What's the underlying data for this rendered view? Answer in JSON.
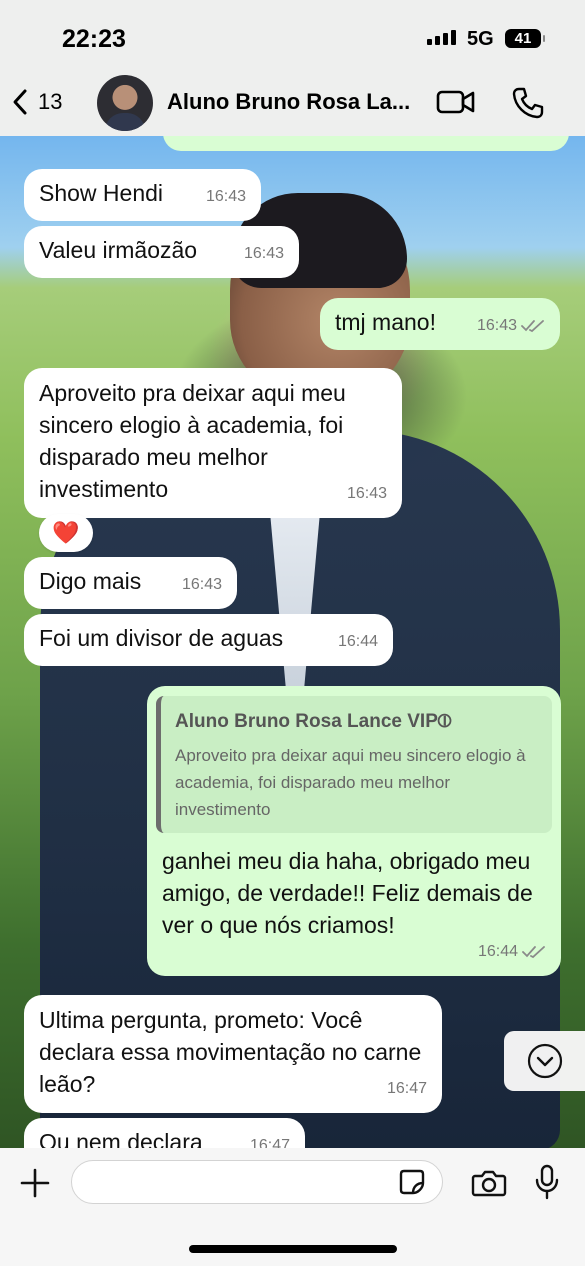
{
  "status_bar": {
    "time": "22:23",
    "network": "5G",
    "battery": "41"
  },
  "header": {
    "back_count": "13",
    "contact_name": "Aluno Bruno Rosa La..."
  },
  "messages": [
    {
      "text": "Show Hendi",
      "time": "16:43"
    },
    {
      "text": "Valeu irmãozão",
      "time": "16:43"
    },
    {
      "text": "tmj mano!",
      "time": "16:43"
    },
    {
      "text": "Aproveito pra deixar aqui meu sincero elogio à academia, foi disparado meu melhor investimento",
      "time": "16:43",
      "reaction": "❤️"
    },
    {
      "text": "Digo mais",
      "time": "16:43"
    },
    {
      "text": "Foi um divisor de aguas",
      "time": "16:44"
    },
    {
      "quote_author": "Aluno Bruno Rosa Lance VIP⦶",
      "quote_text": "Aproveito pra deixar aqui meu sincero elogio à academia, foi disparado meu melhor investimento",
      "text": "ganhei meu dia haha, obrigado meu amigo, de verdade!! Feliz demais de ver o que nós criamos!",
      "time": "16:44"
    },
    {
      "text": "Ultima pergunta, prometo: Você declara essa movimentação no carne leão?",
      "time": "16:47"
    },
    {
      "text": "Ou nem declara",
      "time": "16:47"
    }
  ],
  "icons": {
    "back": "chevron-left-icon",
    "video": "video-camera-icon",
    "call": "phone-icon",
    "read": "double-check-icon",
    "scroll": "chevron-down-icon",
    "plus": "plus-icon",
    "sticker": "sticker-icon",
    "camera": "camera-icon",
    "mic": "microphone-icon"
  },
  "colors": {
    "incoming": "#ffffff",
    "outgoing": "#d9fdd3",
    "read_ticks": "#8a8a8a"
  }
}
